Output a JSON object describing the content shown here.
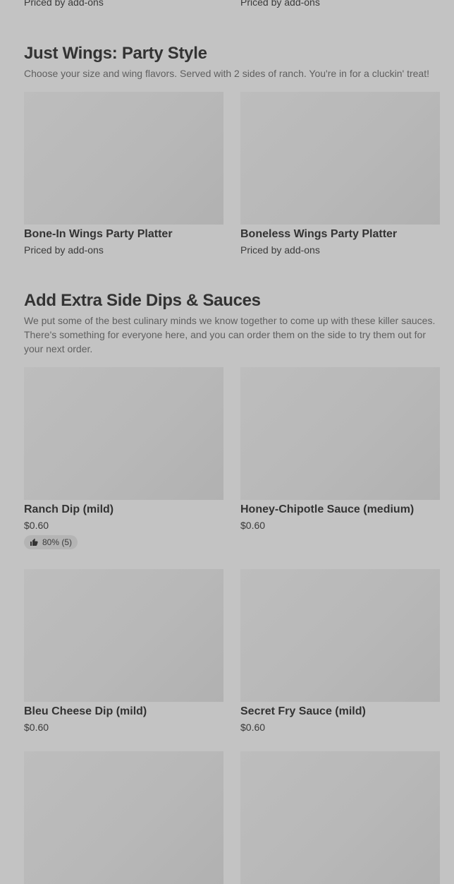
{
  "top": {
    "left_price": "Priced by add-ons",
    "right_price": "Priced by add-ons"
  },
  "sections": [
    {
      "title": "Just Wings: Party Style",
      "description": "Choose your size and wing flavors. Served with 2 sides of ranch. You're in for a cluckin' treat!",
      "items": [
        {
          "name": "Bone-In Wings Party Platter",
          "price": "Priced by add-ons"
        },
        {
          "name": "Boneless Wings Party Platter",
          "price": "Priced by add-ons"
        }
      ]
    },
    {
      "title": "Add Extra Side Dips & Sauces",
      "description": "We put some of the best culinary minds we know together to come up with these killer sauces. There's something for everyone here, and you can order them on the side to try them out for your next order.",
      "items": [
        {
          "name": "Ranch Dip (mild)",
          "price": "$0.60",
          "rating": "80% (5)",
          "rating_icon": "thumbs-up-icon"
        },
        {
          "name": "Honey-Chipotle Sauce (medium)",
          "price": "$0.60"
        },
        {
          "name": "Bleu Cheese Dip (mild)",
          "price": "$0.60"
        },
        {
          "name": "Secret Fry Sauce (mild)",
          "price": "$0.60"
        }
      ]
    }
  ],
  "colors": {
    "background": "#c3c3c3",
    "image_placeholder": "#b9b9b9",
    "badge": "#b4b4b4"
  }
}
